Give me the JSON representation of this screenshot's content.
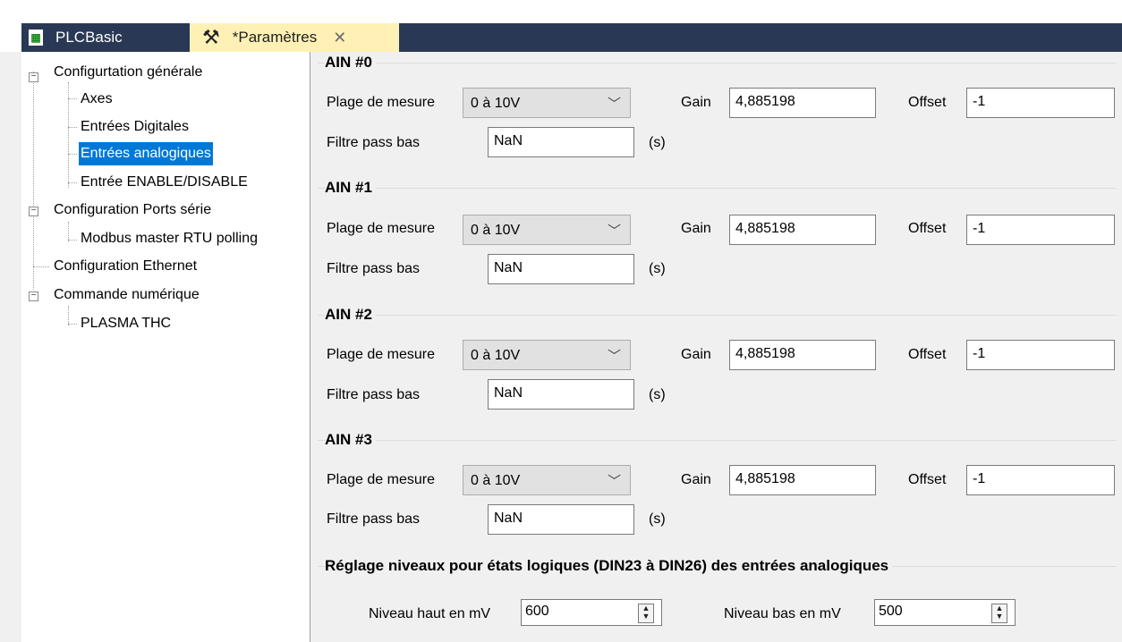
{
  "tabs": [
    {
      "label": "PLCBasic",
      "icon": "plc-file-icon"
    },
    {
      "label": "*Paramètres",
      "icon": "tools-icon",
      "close": "✕"
    }
  ],
  "tree": {
    "items": [
      {
        "label": "Configurtation générale",
        "expanded": true
      },
      {
        "label": "Axes"
      },
      {
        "label": "Entrées Digitales"
      },
      {
        "label": "Entrées analogiques",
        "selected": true
      },
      {
        "label": "Entrée ENABLE/DISABLE"
      },
      {
        "label": "Configuration Ports série",
        "expanded": true
      },
      {
        "label": "Modbus master RTU polling"
      },
      {
        "label": "Configuration Ethernet"
      },
      {
        "label": "Commande numérique",
        "expanded": true
      },
      {
        "label": "PLASMA THC"
      }
    ]
  },
  "labels": {
    "range": "Plage de mesure",
    "gain": "Gain",
    "offset": "Offset",
    "filter": "Filtre pass bas",
    "unit": "(s)"
  },
  "ain": [
    {
      "title": "AIN #0",
      "range": "0 à 10V",
      "gain": "4,885198",
      "offset": "-1",
      "filter": "NaN"
    },
    {
      "title": "AIN #1",
      "range": "0 à 10V",
      "gain": "4,885198",
      "offset": "-1",
      "filter": "NaN"
    },
    {
      "title": "AIN #2",
      "range": "0 à 10V",
      "gain": "4,885198",
      "offset": "-1",
      "filter": "NaN"
    },
    {
      "title": "AIN #3",
      "range": "0 à 10V",
      "gain": "4,885198",
      "offset": "-1",
      "filter": "NaN"
    }
  ],
  "levels": {
    "title": "Réglage niveaux pour états logiques (DIN23 à DIN26) des entrées analogiques",
    "high_label": "Niveau haut en mV",
    "high_value": "600",
    "low_label": "Niveau bas en mV",
    "low_value": "500"
  },
  "colors": {
    "tab_bar": "#293955",
    "active_tab": "#fff1b5",
    "selection": "#0078d7"
  }
}
